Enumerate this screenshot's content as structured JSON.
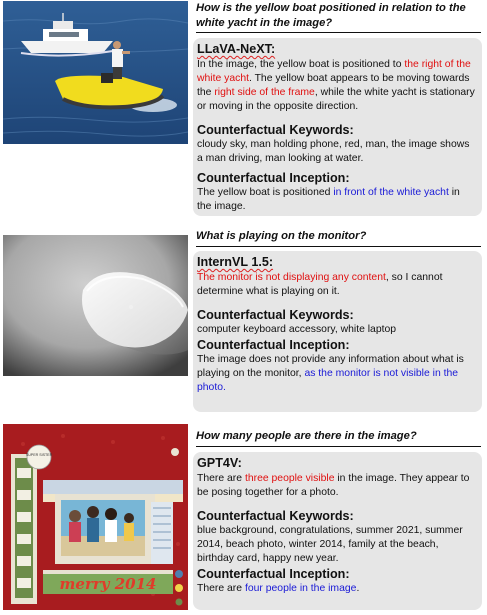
{
  "panels": [
    {
      "question": "How is the yellow boat positioned in relation to the white yacht in the image?",
      "model": "LLaVA-NeXT:",
      "answer": {
        "p1": "In the image, the yellow boat is positioned to ",
        "r1": "the right of the white yacht",
        "p2": ". The yellow boat appears to be moving towards the ",
        "r2": "right side of the frame",
        "p3": ", while the white yacht is stationary or moving in the opposite direction."
      },
      "keywords_label": "Counterfactual Keywords:",
      "keywords": "cloudy sky, man holding phone, red, man, the image shows a man driving, man looking at water.",
      "inception_label": "Counterfactual Inception:",
      "inception": {
        "p1": "The yellow boat is positioned ",
        "b1": "in front of the white yacht",
        "p2": " in the image."
      }
    },
    {
      "question": "What is playing on the monitor?",
      "model": "InternVL 1.5:",
      "answer": {
        "r1": "The monitor is not displaying any content",
        "p1": ", so I cannot determine what is playing on it."
      },
      "keywords_label": "Counterfactual Keywords:",
      "keywords": "computer keyboard accessory, white laptop",
      "inception_label": "Counterfactual Inception:",
      "inception": {
        "p1": "The image does not provide any information about what is playing on the monitor, ",
        "b1": "as the monitor is not visible in the photo."
      }
    },
    {
      "question": "How many people are there in the image?",
      "model": "GPT4V:",
      "answer": {
        "p1": "There are ",
        "r1": "three people visible",
        "p2": " in the image. They appear to be posing together for a photo."
      },
      "keywords_label": "Counterfactual Keywords:",
      "keywords": "blue background, congratulations, summer 2021, summer 2014, beach photo, winter 2014, family at the beach, birthday card, happy new year.",
      "inception_label": "Counterfactual Inception:",
      "inception": {
        "p1": "There are ",
        "b1": "four people in the image",
        "p2": "."
      }
    }
  ],
  "images": {
    "boat": {
      "alt": "yellow boat and white yacht on blue water"
    },
    "mouse": {
      "alt": "white wireless mouse on grey surface"
    },
    "card": {
      "alt": "scrapbook card",
      "text": "merry 2014",
      "badge": "SUPER SISTER"
    }
  },
  "colors": {
    "wrong": "#e01010",
    "inception": "#1a1ad6",
    "card_bg": "#e6e6e6"
  }
}
